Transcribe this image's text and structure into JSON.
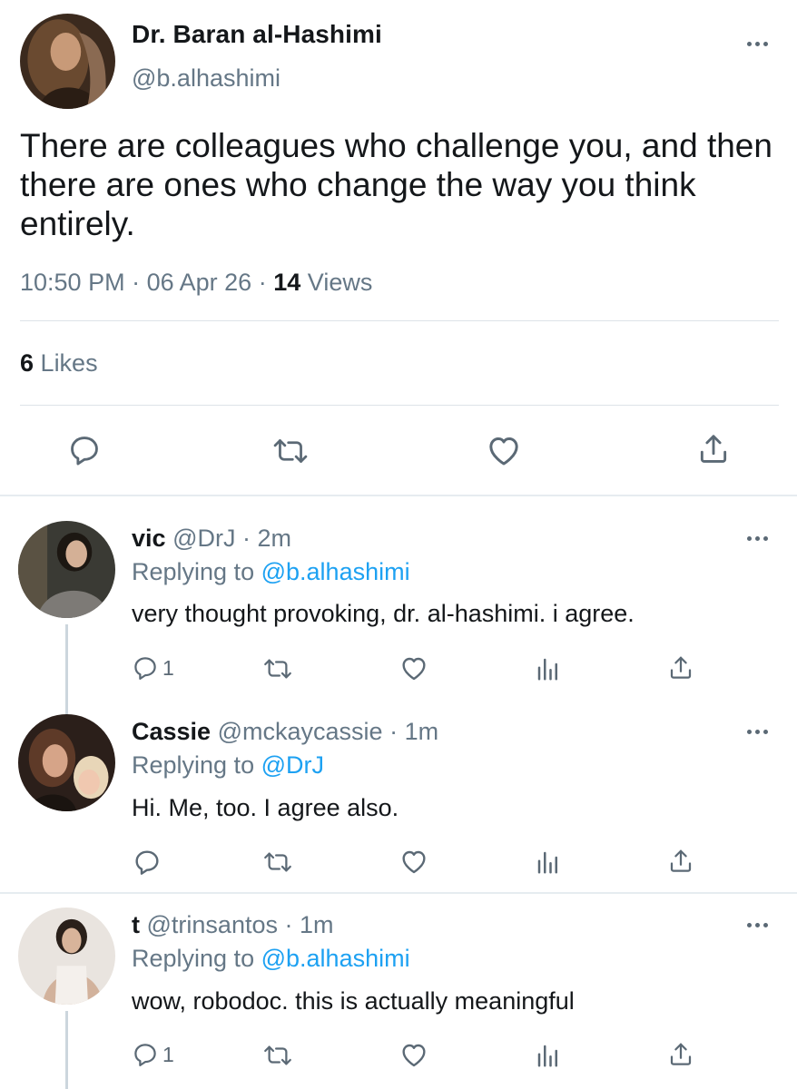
{
  "tweet": {
    "author_name": "Dr. Baran al-Hashimi",
    "author_handle": "@b.alhashimi",
    "text": "There are colleagues who challenge you, and then there are ones who change the way you think entirely.",
    "time": "10:50 PM",
    "date": "06 Apr 26",
    "separator": "·",
    "views_count": "14",
    "views_label": "Views",
    "likes_count": "6",
    "likes_label": "Likes",
    "icons": [
      "reply-icon",
      "retweet-icon",
      "like-icon",
      "share-icon",
      "more-icon"
    ]
  },
  "replies": [
    {
      "name": "vic",
      "handle": "@DrJ",
      "time": "2m",
      "replying_prefix": "Replying to",
      "replying_to": "@b.alhashimi",
      "text": "very thought provoking, dr. al-hashimi. i agree.",
      "reply_count": "1"
    },
    {
      "name": "Cassie",
      "handle": "@mckaycassie",
      "time": "1m",
      "replying_prefix": "Replying to",
      "replying_to": "@DrJ",
      "text": "Hi. Me, too. I agree also.",
      "reply_count": ""
    },
    {
      "name": "t",
      "handle": "@trinsantos",
      "time": "1m",
      "replying_prefix": "Replying to",
      "replying_to": "@b.alhashimi",
      "text": "wow, robodoc. this is actually meaningful",
      "reply_count": "1"
    }
  ],
  "colors": {
    "text": "#14171a",
    "secondary": "#657786",
    "link": "#1da1f2",
    "divider": "#dde3e8"
  }
}
